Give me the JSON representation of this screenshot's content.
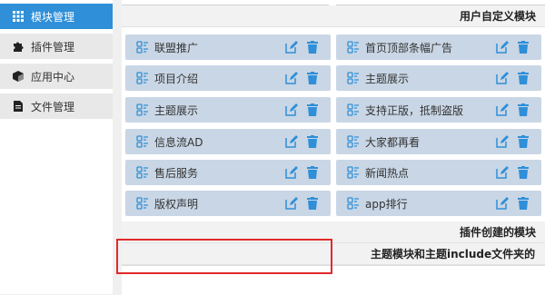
{
  "sidebar": {
    "items": [
      {
        "label": "模块管理",
        "icon": "grid-icon",
        "active": true
      },
      {
        "label": "插件管理",
        "icon": "puzzle-icon",
        "active": false
      },
      {
        "label": "应用中心",
        "icon": "cube-icon",
        "active": false
      },
      {
        "label": "文件管理",
        "icon": "file-icon",
        "active": false
      }
    ]
  },
  "sections": {
    "user_defined": "用户自定义模块",
    "plugin_created": "插件创建的模块",
    "theme_include": "主题模块和主题include文件夹的"
  },
  "modules": [
    {
      "label": "联盟推广"
    },
    {
      "label": "首页顶部条幅广告"
    },
    {
      "label": "项目介绍"
    },
    {
      "label": "主题展示"
    },
    {
      "label": "主题展示"
    },
    {
      "label": "支持正版，抵制盗版"
    },
    {
      "label": "信息流AD"
    },
    {
      "label": "大家都再看"
    },
    {
      "label": "售后服务"
    },
    {
      "label": "新闻热点"
    },
    {
      "label": "版权声明"
    },
    {
      "label": "app排行"
    }
  ],
  "colors": {
    "accent": "#2f8fd8",
    "module_bg": "#c9d6e5",
    "icon_blue": "#2f8fd8",
    "highlight_red": "#e02a2a"
  }
}
